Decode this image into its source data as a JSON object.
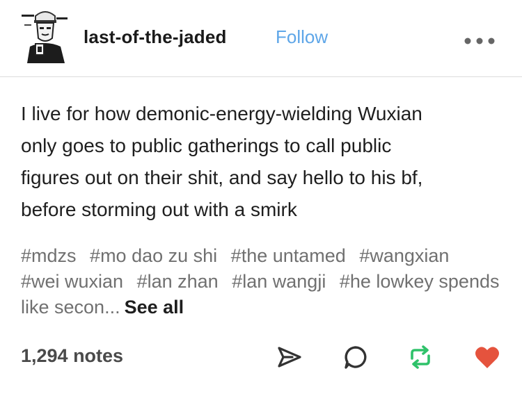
{
  "post": {
    "author": "last-of-the-jaded",
    "follow_label": "Follow",
    "text": "I live for how demonic-energy-wielding Wuxian\nonly goes to public gatherings to call public\nfigures out on their shit, and say hello to his bf,\nbefore storming out with a smirk",
    "tags": [
      "#mdzs",
      "#mo dao zu shi",
      "#the untamed",
      "#wangxian",
      "#wei wuxian",
      "#lan zhan",
      "#lan wangji",
      "#he lowkey spends like secon..."
    ],
    "see_all_label": "See all",
    "notes": "1,294 notes"
  },
  "icons": {
    "more": "more-options-icon",
    "share": "share-icon",
    "reply": "reply-icon",
    "reblog": "reblog-icon",
    "like": "heart-icon"
  },
  "colors": {
    "follow": "#5ea6e8",
    "reblog": "#2fc26a",
    "like": "#e5533d",
    "tag": "#707070"
  }
}
